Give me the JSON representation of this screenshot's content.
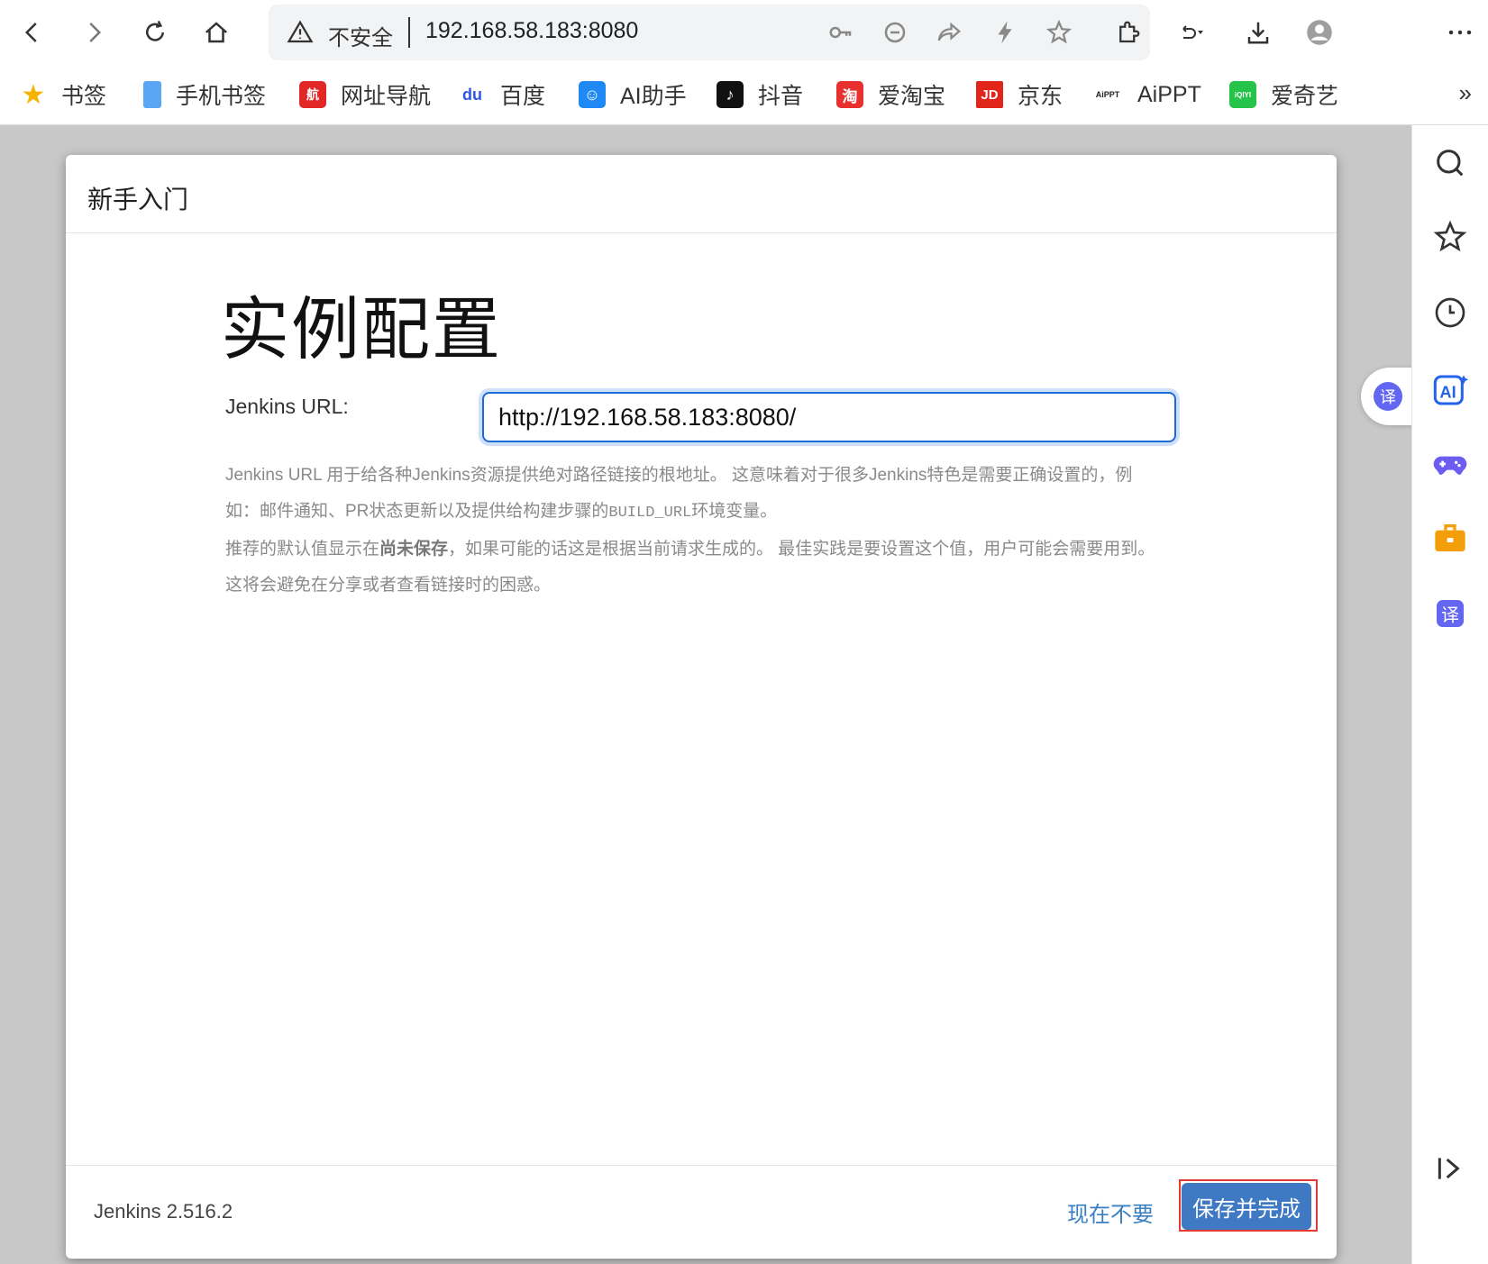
{
  "browser": {
    "security_label": "不安全",
    "address": "192.168.58.183:8080"
  },
  "bookmarks": [
    {
      "label": "书签",
      "icon": "star-icon",
      "color": "#f6b400",
      "glyph": "★"
    },
    {
      "label": "手机书签",
      "icon": "phone-bookmark-icon",
      "color": "#5aa6f5",
      "glyph": ""
    },
    {
      "label": "网址导航",
      "icon": "nav-icon",
      "color": "#e32727",
      "glyph": "航"
    },
    {
      "label": "百度",
      "icon": "baidu-icon",
      "color": "#2d57e3",
      "glyph": "du"
    },
    {
      "label": "AI助手",
      "icon": "ai-assistant-icon",
      "color": "#1e88f5",
      "glyph": "☺"
    },
    {
      "label": "抖音",
      "icon": "douyin-icon",
      "color": "#111111",
      "glyph": "♪"
    },
    {
      "label": "爱淘宝",
      "icon": "taobao-icon",
      "color": "#e8312f",
      "glyph": "淘"
    },
    {
      "label": "京东",
      "icon": "jd-icon",
      "color": "#e1251b",
      "glyph": "JD"
    },
    {
      "label": "AiPPT",
      "icon": "aippt-icon",
      "color": "#ffffff",
      "glyph": "AiPPT"
    },
    {
      "label": "爱奇艺",
      "icon": "iqiyi-icon",
      "color": "#25c34a",
      "glyph": "iQIYI"
    }
  ],
  "bookmarks_more": "»",
  "dialog": {
    "header_title": "新手入门",
    "page_title": "实例配置",
    "field_label": "Jenkins URL:",
    "url_value": "http://192.168.58.183:8080/",
    "help": {
      "line1_prefix": "Jenkins URL 用于给各种Jenkins资源提供绝对路径链接的根地址。 这意味着对于很多Jenkins特色是需要正确设置的，例如：邮件通知、PR状态更新以及提供给构建步骤的",
      "line1_code": "BUILD_URL",
      "line1_suffix": "环境变量。",
      "line2_prefix": "推荐的默认值显示在",
      "line2_bold": "尚未保存",
      "line2_suffix": "，如果可能的话这是根据当前请求生成的。 最佳实践是要设置这个值，用户可能会需要用到。这将会避免在分享或者查看链接时的困惑。"
    },
    "version": "Jenkins 2.516.2",
    "skip_label": "现在不要",
    "save_label": "保存并完成"
  },
  "translate_float": "译",
  "colors": {
    "accent": "#3f79c3",
    "link": "#3a7fc1",
    "focus_border": "#1e6bd6",
    "highlight": "#e53935"
  }
}
